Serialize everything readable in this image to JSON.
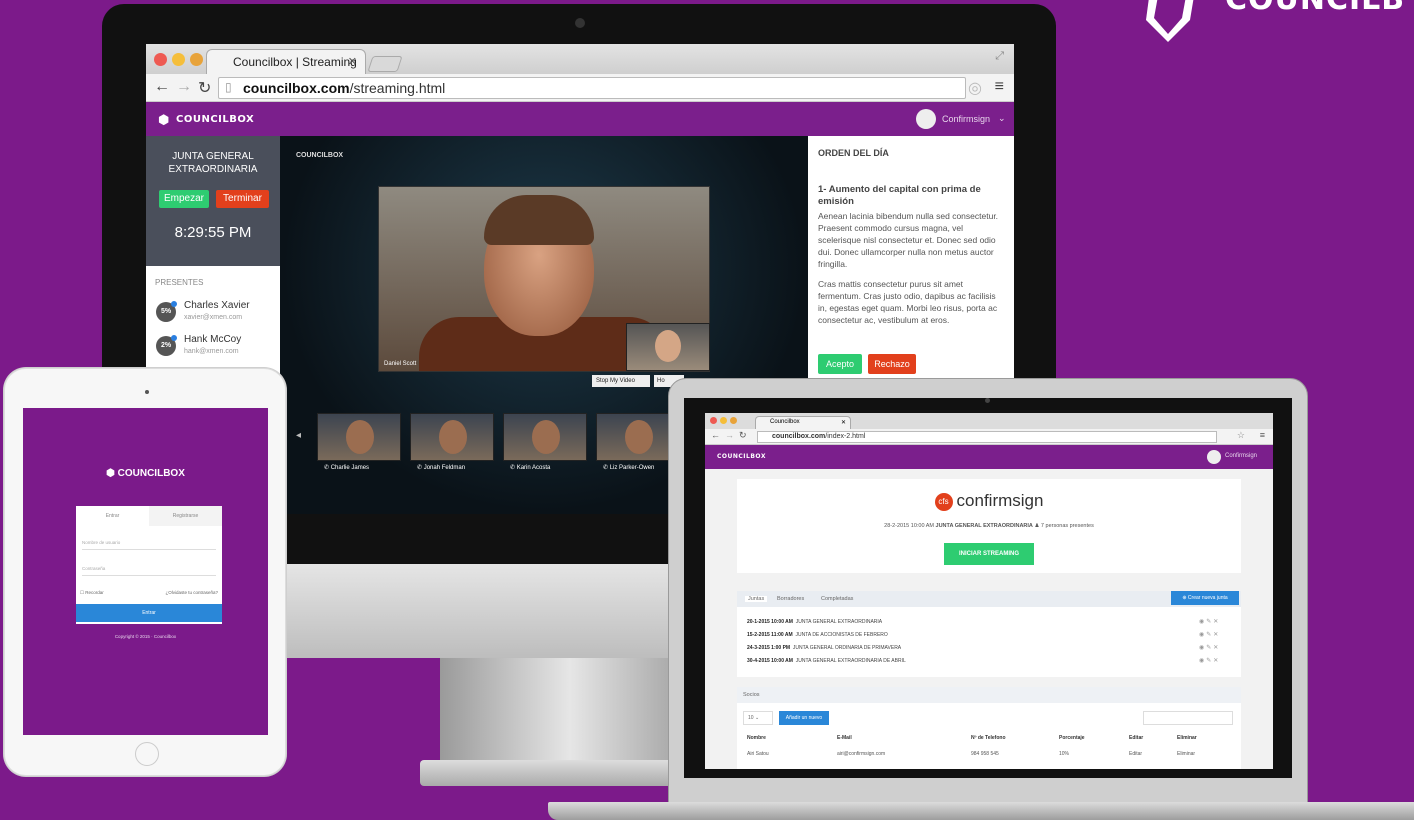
{
  "corner_brand": {
    "text": "COUNCILB"
  },
  "imac_browser": {
    "tab_title": "Councilbox | Streaming",
    "url_domain": "councilbox.com",
    "url_path": "/streaming.html",
    "logo_text": "COUNCILBOX",
    "user_menu": "Confirmsign",
    "sidebar": {
      "meeting_name_line1": "JUNTA GENERAL",
      "meeting_name_line2": "EXTRAORDINARIA",
      "start_label": "Empezar",
      "end_label": "Terminar",
      "clock": "8:29:55 PM",
      "attendees_heading": "PRESENTES",
      "attendees": [
        {
          "pct": "5%",
          "name": "Charles Xavier",
          "email": "xavier@xmen.com"
        },
        {
          "pct": "2%",
          "name": "Hank McCoy",
          "email": "hank@xmen.com"
        }
      ]
    },
    "video": {
      "watermark": "COUNCILBOX",
      "speaker_caption": "Daniel Scott",
      "stop_video_label": "Stop My Video",
      "hold_label": "Ho",
      "thumbnails": [
        "Charlie James",
        "Jonah Feldman",
        "Karin Acosta",
        "Liz Parker-Owen"
      ]
    },
    "agenda": {
      "title": "ORDEN DEL DÍA",
      "item_title": "1- Aumento del capital con prima de emisión",
      "paragraph1": "Aenean lacinia bibendum nulla sed consectetur. Praesent commodo cursus magna, vel scelerisque nisl consectetur et. Donec sed odio dui. Donec ullamcorper nulla non metus auctor fringilla.",
      "paragraph2": "Cras mattis consectetur purus sit amet fermentum. Cras justo odio, dapibus ac facilisis in, egestas eget quam. Morbi leo risus, porta ac consectetur ac, vestibulum at eros.",
      "accept_label": "Acepto",
      "reject_label": "Rechazo"
    }
  },
  "tablet": {
    "logo_text": "COUNCILBOX",
    "tab_login": "Entrar",
    "tab_register": "Registrarse",
    "username_placeholder": "Nombre de usuario",
    "password_placeholder": "Contraseña",
    "remember_label": "Recordar",
    "forgot_label": "¿Olvidaste tu contraseña?",
    "submit_label": "Entrar",
    "copyright": "Copyright © 2015 · Councilbox"
  },
  "laptop_browser": {
    "tab_title": "Councilbox",
    "url_domain": "councilbox.com",
    "url_path": "/index-2.html",
    "logo_text": "COUNCILBOX",
    "user_menu": "Confirmsign",
    "company": "confirmsign",
    "meeting_datetime": "28-2-2015 10:00 AM",
    "meeting_name": "JUNTA GENERAL EXTRAORDINARIA",
    "attendees_count": "7 personas presentes",
    "start_stream_label": "INICIAR STREAMING",
    "tabs": [
      "Juntas",
      "Borradores",
      "Completadas"
    ],
    "new_meeting_label": "Crear nueva junta",
    "meetings": [
      {
        "date": "20-1-2015 10:00 AM",
        "name": "JUNTA GENERAL EXTRAORDINARIA"
      },
      {
        "date": "15-2-2015 11:00 AM",
        "name": "JUNTA DE ACCIONISTAS DE FEBRERO"
      },
      {
        "date": "24-3-2015 1:00 PM",
        "name": "JUNTA GENERAL ORDINARIA DE PRIMAVERA"
      },
      {
        "date": "30-4-2015 10:00 AM",
        "name": "JUNTA GENERAL EXTRAORDINARIA DE ABRIL"
      }
    ],
    "socios": {
      "title": "Socios",
      "page_size": "10",
      "add_label": "Añadir un nuevo",
      "columns": [
        "Nombre",
        "E-Mail",
        "Nº de Telefono",
        "Porcentaje",
        "Editar",
        "Eliminar"
      ],
      "rows": [
        {
          "name": "Airi Satou",
          "email": "airi@confirmsign.com",
          "phone": "984 958 545",
          "pct": "10%",
          "edit": "Editar",
          "delete": "Eliminar"
        }
      ]
    }
  }
}
